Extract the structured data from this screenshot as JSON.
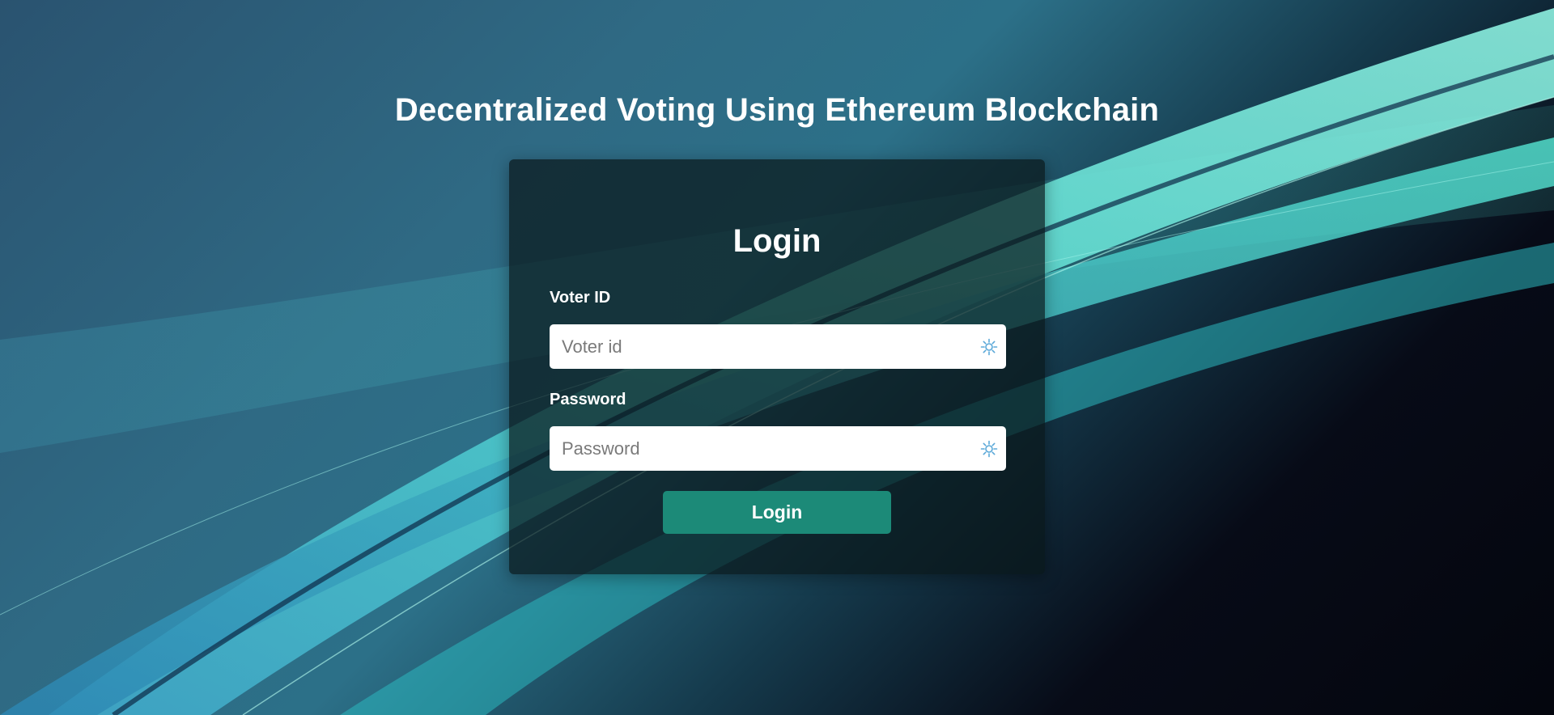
{
  "page": {
    "title": "Decentralized Voting Using Ethereum Blockchain"
  },
  "login_form": {
    "heading": "Login",
    "voter_id": {
      "label": "Voter ID",
      "placeholder": "Voter id",
      "value": "",
      "icon": "autofill-icon"
    },
    "password": {
      "label": "Password",
      "placeholder": "Password",
      "value": "",
      "icon": "autofill-icon"
    },
    "submit_label": "Login"
  },
  "colors": {
    "button": "#1c8a78",
    "card": "rgba(10,24,26,0.72)",
    "accent_teal": "#4fe3c8"
  }
}
